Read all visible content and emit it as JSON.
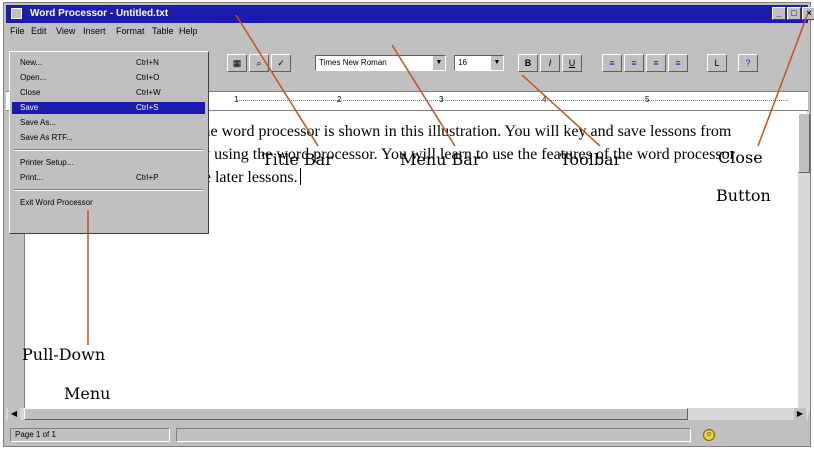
{
  "window": {
    "title": "Word Processor - Untitled.txt"
  },
  "window_controls": {
    "minimize": "_",
    "maximize": "□",
    "close": "×"
  },
  "menubar": [
    "File",
    "Edit",
    "View",
    "Insert",
    "Format",
    "Table",
    "Help"
  ],
  "file_menu": {
    "items": [
      {
        "label": "New...",
        "shortcut": "Ctrl+N"
      },
      {
        "label": "Open...",
        "shortcut": "Ctrl+O"
      },
      {
        "label": "Close",
        "shortcut": "Ctrl+W"
      },
      {
        "label": "Save",
        "shortcut": "Ctrl+S"
      },
      {
        "label": "Save As...",
        "shortcut": ""
      },
      {
        "label": "Save As RTF...",
        "shortcut": ""
      },
      {
        "label": "Printer Setup...",
        "shortcut": ""
      },
      {
        "label": "Print...",
        "shortcut": "Ctrl+P"
      },
      {
        "label": "Exit Word Processor",
        "shortcut": ""
      }
    ]
  },
  "toolbar": {
    "font_name": "Times New Roman",
    "font_size": "16",
    "bold": "B",
    "italic": "I",
    "underline": "U",
    "help": "?"
  },
  "ruler": {
    "marks": [
      "1",
      "2",
      "3",
      "4",
      "5"
    ]
  },
  "document": {
    "text": "The Typing Time word processor is shown in this illustration. You will key and save lessons from this textbook by using the word processor. You will learn to use the features of the word processor as you complete later lessons."
  },
  "statusbar": {
    "page": "Page 1 of 1"
  },
  "callouts": {
    "title_bar": "Title Bar",
    "menu_bar": "Menu Bar",
    "toolbar": "Toolbar",
    "close_button_line1": "Close",
    "close_button_line2": "Button",
    "pulldown_line1": "Pull-Down",
    "pulldown_line2": "Menu"
  },
  "colors": {
    "title_bar": "#1b1bb0",
    "selection": "#1b1bb0",
    "callout_line": "#c8501e"
  }
}
